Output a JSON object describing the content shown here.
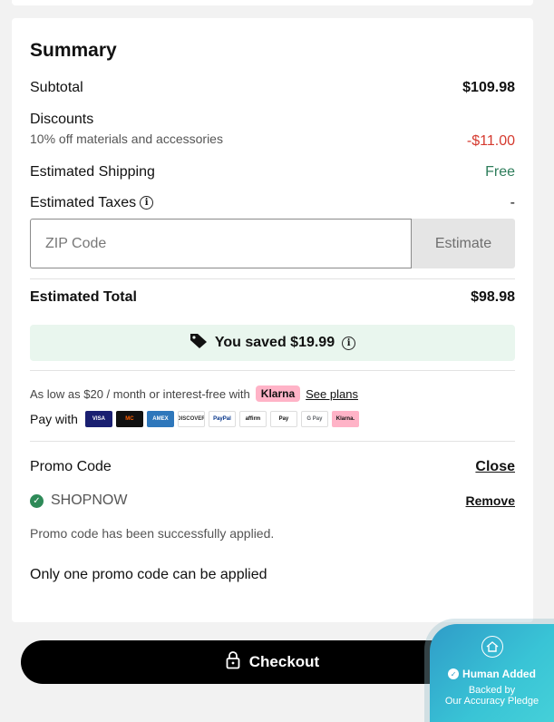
{
  "summary": {
    "title": "Summary",
    "subtotal_label": "Subtotal",
    "subtotal_value": "$109.98",
    "discounts_label": "Discounts",
    "discount_desc": "10% off materials and accessories",
    "discount_value": "-$11.00",
    "shipping_label": "Estimated Shipping",
    "shipping_value": "Free",
    "taxes_label": "Estimated Taxes",
    "taxes_value": "-",
    "info_icon": "i",
    "zip_placeholder": "ZIP Code",
    "estimate_label": "Estimate",
    "total_label": "Estimated Total",
    "total_value": "$98.98",
    "saved_text": "You saved $19.99"
  },
  "klarna": {
    "prefix": "As low as $20 / month or interest-free with",
    "brand": "Klarna",
    "link": "See plans"
  },
  "payment": {
    "label": "Pay with",
    "methods": [
      {
        "name": "VISA",
        "bg": "#1a1f71",
        "fg": "#ffffff"
      },
      {
        "name": "MC",
        "bg": "#111111",
        "fg": "#ff5f00"
      },
      {
        "name": "AMEX",
        "bg": "#2e77bb",
        "fg": "#ffffff"
      },
      {
        "name": "DISCOVER",
        "bg": "#ffffff",
        "fg": "#333333"
      },
      {
        "name": "PayPal",
        "bg": "#ffffff",
        "fg": "#003087"
      },
      {
        "name": "affirm",
        "bg": "#ffffff",
        "fg": "#111111"
      },
      {
        "name": "Pay",
        "bg": "#ffffff",
        "fg": "#111111"
      },
      {
        "name": "G Pay",
        "bg": "#ffffff",
        "fg": "#5f6368"
      },
      {
        "name": "Klarna.",
        "bg": "#ffb3c7",
        "fg": "#111111"
      }
    ]
  },
  "promo": {
    "title": "Promo Code",
    "close": "Close",
    "code": "SHOPNOW",
    "remove": "Remove",
    "success": "Promo code has been successfully applied.",
    "note": "Only one promo code can be applied"
  },
  "checkout": {
    "label": "Checkout"
  },
  "trust_badge": {
    "title": "Human Added",
    "line1": "Backed by",
    "line2": "Our Accuracy Pledge"
  },
  "colors": {
    "discount": "#d53a2f",
    "free": "#2e7d5b",
    "saved_bg": "#e9f6ee",
    "klarna": "#ffb3c7"
  }
}
